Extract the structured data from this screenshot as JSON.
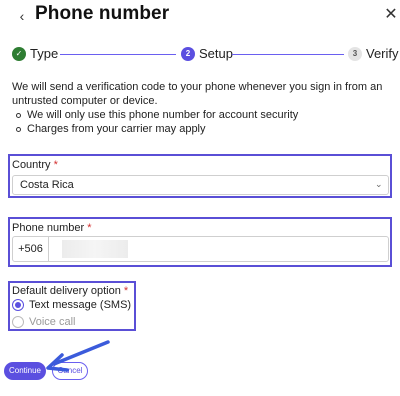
{
  "header": {
    "back_glyph": "‹",
    "title": "Phone number",
    "close_glyph": "✕"
  },
  "stepper": {
    "steps": [
      {
        "marker": "✓",
        "label": "Type",
        "state": "done"
      },
      {
        "marker": "2",
        "label": "Setup",
        "state": "active"
      },
      {
        "marker": "3",
        "label": "Verify",
        "state": "todo"
      }
    ]
  },
  "intro": "We will send a verification code to your phone whenever you sign in from an untrusted computer or device.",
  "bullets": [
    "We will only use this phone number for account security",
    "Charges from your carrier may apply"
  ],
  "country": {
    "label": "Country",
    "required_mark": "*",
    "value": "Costa Rica"
  },
  "phone": {
    "label": "Phone number",
    "required_mark": "*",
    "prefix": "+506",
    "value": ""
  },
  "delivery": {
    "label": "Default delivery option",
    "required_mark": "*",
    "options": [
      {
        "label": "Text message (SMS)",
        "selected": true,
        "enabled": true
      },
      {
        "label": "Voice call",
        "selected": false,
        "enabled": false
      }
    ]
  },
  "actions": {
    "continue_label": "Continue",
    "cancel_label": "Cancel"
  },
  "colors": {
    "accent": "#5b4fe0",
    "highlight": "#5a4fd6",
    "success": "#2e7d32",
    "required": "#d32f2f"
  }
}
